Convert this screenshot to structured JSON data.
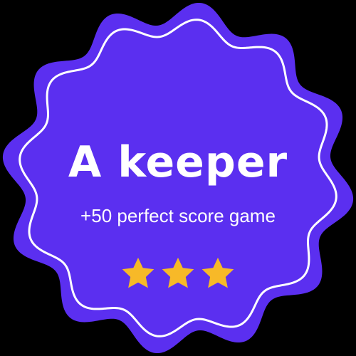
{
  "badge": {
    "title": "A keeper",
    "subtitle": "+50 perfect score game",
    "stars_count": 3
  },
  "colors": {
    "background": "#000000",
    "badge_fill": "#5b2ff0",
    "outline": "#ffffff",
    "text": "#ffffff",
    "star": "#f7b928"
  },
  "icons": {
    "star": "star-icon"
  }
}
